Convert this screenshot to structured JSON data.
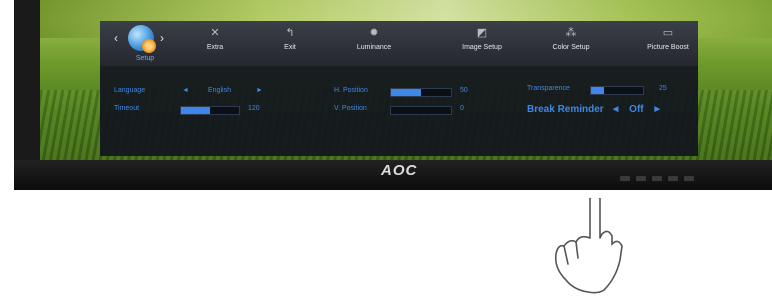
{
  "brand": {
    "logo": "AOC"
  },
  "menu": {
    "selected_label": "Setup",
    "items": [
      {
        "label": "Extra",
        "icon": "extra-icon"
      },
      {
        "label": "Exit",
        "icon": "exit-icon"
      },
      {
        "label": "Luminance",
        "icon": "luminance-icon"
      },
      {
        "label": "Image Setup",
        "icon": "image-setup-icon"
      },
      {
        "label": "Color Setup",
        "icon": "color-setup-icon"
      },
      {
        "label": "Picture Boost",
        "icon": "picture-boost-icon"
      }
    ]
  },
  "settings": {
    "language": {
      "label": "Language",
      "left": "◄",
      "value": "English",
      "right": "►"
    },
    "timeout": {
      "label": "Timeout",
      "value": "120",
      "level": 0.5
    },
    "h_position": {
      "label": "H. Position",
      "value": "50",
      "level": 0.5
    },
    "v_position": {
      "label": "V. Position",
      "value": "0",
      "level": 0.0
    },
    "transparence": {
      "label": "Transparence",
      "value": "25",
      "level": 0.25
    },
    "break_reminder": {
      "label": "Break Reminder",
      "left": "◄",
      "value": "Off",
      "right": "►"
    }
  },
  "colors": {
    "accent": "#3f86e8",
    "osd_bg": "#12161e"
  }
}
